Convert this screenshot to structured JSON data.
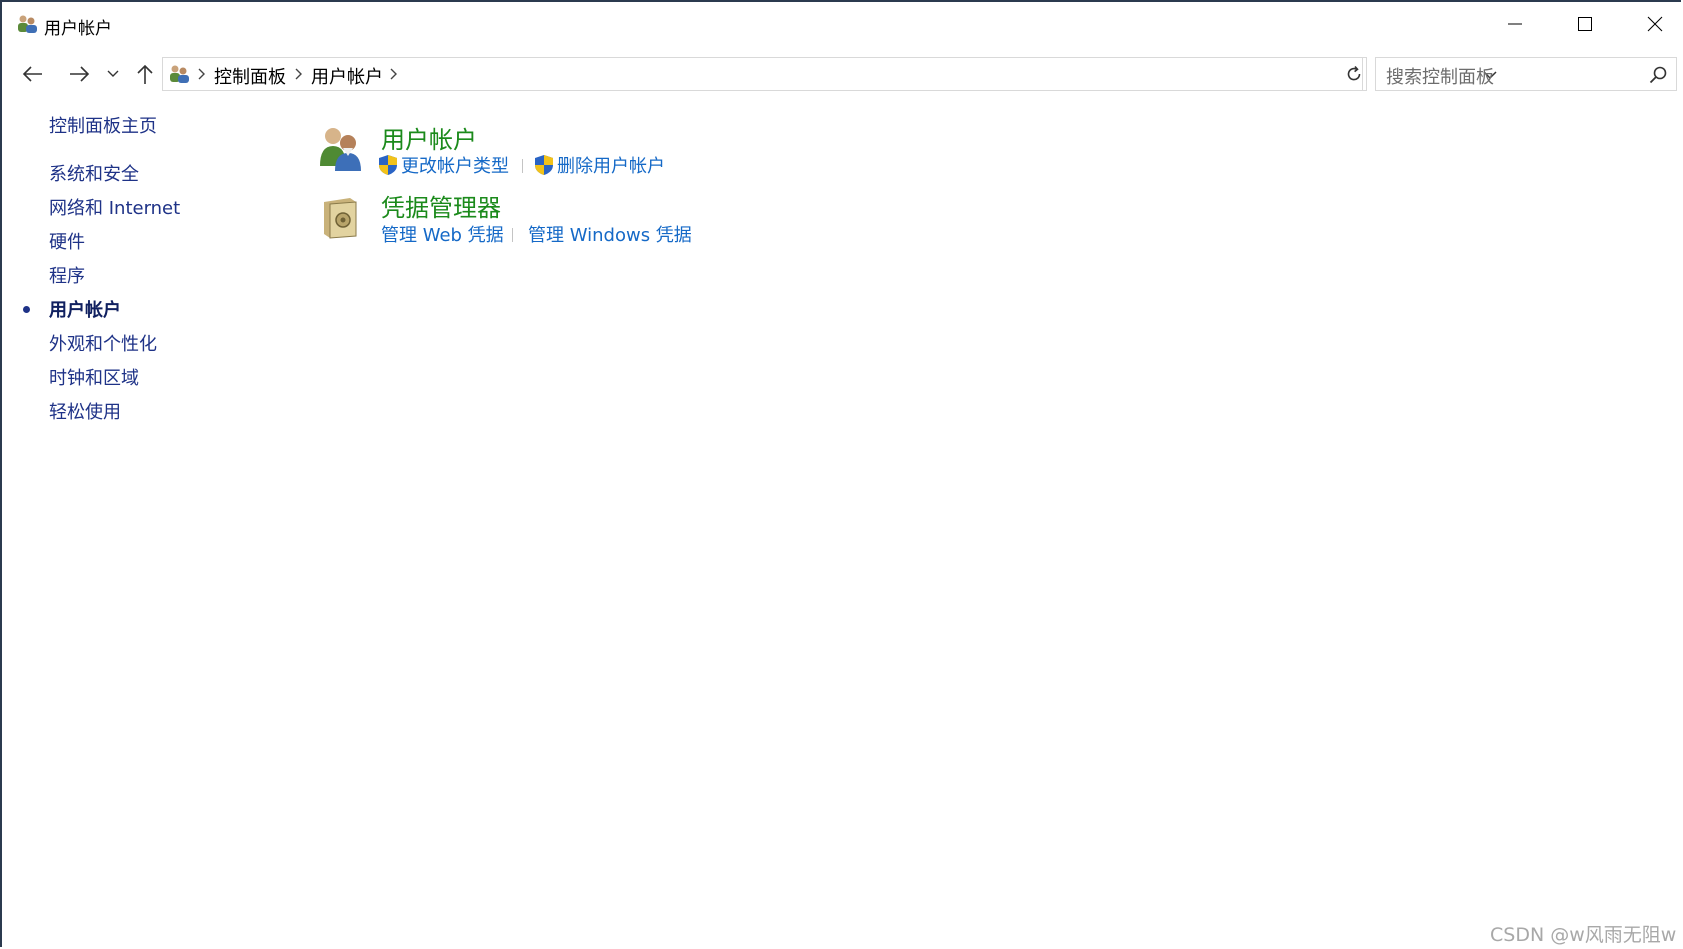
{
  "window": {
    "title": "用户帐户"
  },
  "address": {
    "crumbs": [
      "控制面板",
      "用户帐户"
    ],
    "search_placeholder": "搜索控制面板"
  },
  "sidebar": {
    "home": "控制面板主页",
    "items": [
      {
        "label": "系统和安全",
        "current": false
      },
      {
        "label": "网络和 Internet",
        "current": false
      },
      {
        "label": "硬件",
        "current": false
      },
      {
        "label": "程序",
        "current": false
      },
      {
        "label": "用户帐户",
        "current": true
      },
      {
        "label": "外观和个性化",
        "current": false
      },
      {
        "label": "时钟和区域",
        "current": false
      },
      {
        "label": "轻松使用",
        "current": false
      }
    ]
  },
  "main": {
    "categories": [
      {
        "title": "用户帐户",
        "icon": "users-icon",
        "tasks": [
          {
            "label": "更改帐户类型",
            "icon": "uac-shield-icon"
          },
          {
            "label": "删除用户帐户",
            "icon": "uac-shield-icon"
          }
        ]
      },
      {
        "title": "凭据管理器",
        "icon": "safe-icon",
        "tasks": [
          {
            "label": "管理 Web 凭据"
          },
          {
            "label": "管理 Windows 凭据"
          }
        ]
      }
    ]
  },
  "watermark": "CSDN @w风雨无阻w",
  "colors": {
    "category_title": "#1b8a1b",
    "task_link": "#1569c7",
    "nav_link": "#1e3287"
  }
}
